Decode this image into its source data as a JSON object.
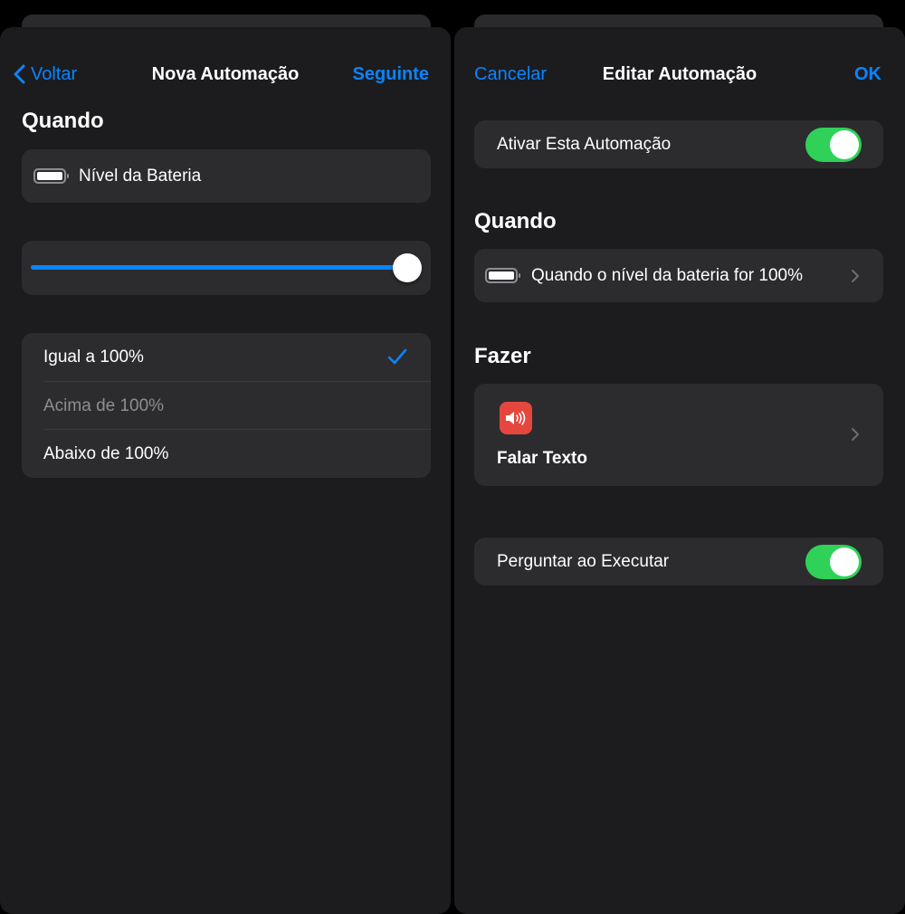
{
  "left": {
    "nav": {
      "back_label": "Voltar",
      "title": "Nova Automação",
      "next_label": "Seguinte"
    },
    "when_title": "Quando",
    "trigger_label": "Nível da Bateria",
    "slider": {
      "value_percent": 100
    },
    "options": [
      {
        "label": "Igual a 100%",
        "selected": true
      },
      {
        "label": "Acima de 100%",
        "selected": false,
        "disabled": true
      },
      {
        "label": "Abaixo de 100%",
        "selected": false
      }
    ]
  },
  "right": {
    "nav": {
      "cancel_label": "Cancelar",
      "title": "Editar Automação",
      "ok_label": "OK"
    },
    "enable_label": "Ativar Esta Automação",
    "enable_on": true,
    "when_title": "Quando",
    "trigger_summary": "Quando o nível da bateria for 100%",
    "do_title": "Fazer",
    "action_label": "Falar Texto",
    "action_icon": "speaker-wave-icon",
    "ask_label": "Perguntar ao Executar",
    "ask_on": true
  },
  "colors": {
    "accent": "#0a84ff",
    "toggle_on": "#30d158",
    "action_icon_bg": "#e5473e",
    "panel_bg": "#1c1c1e",
    "card_bg": "#2c2c2e"
  }
}
